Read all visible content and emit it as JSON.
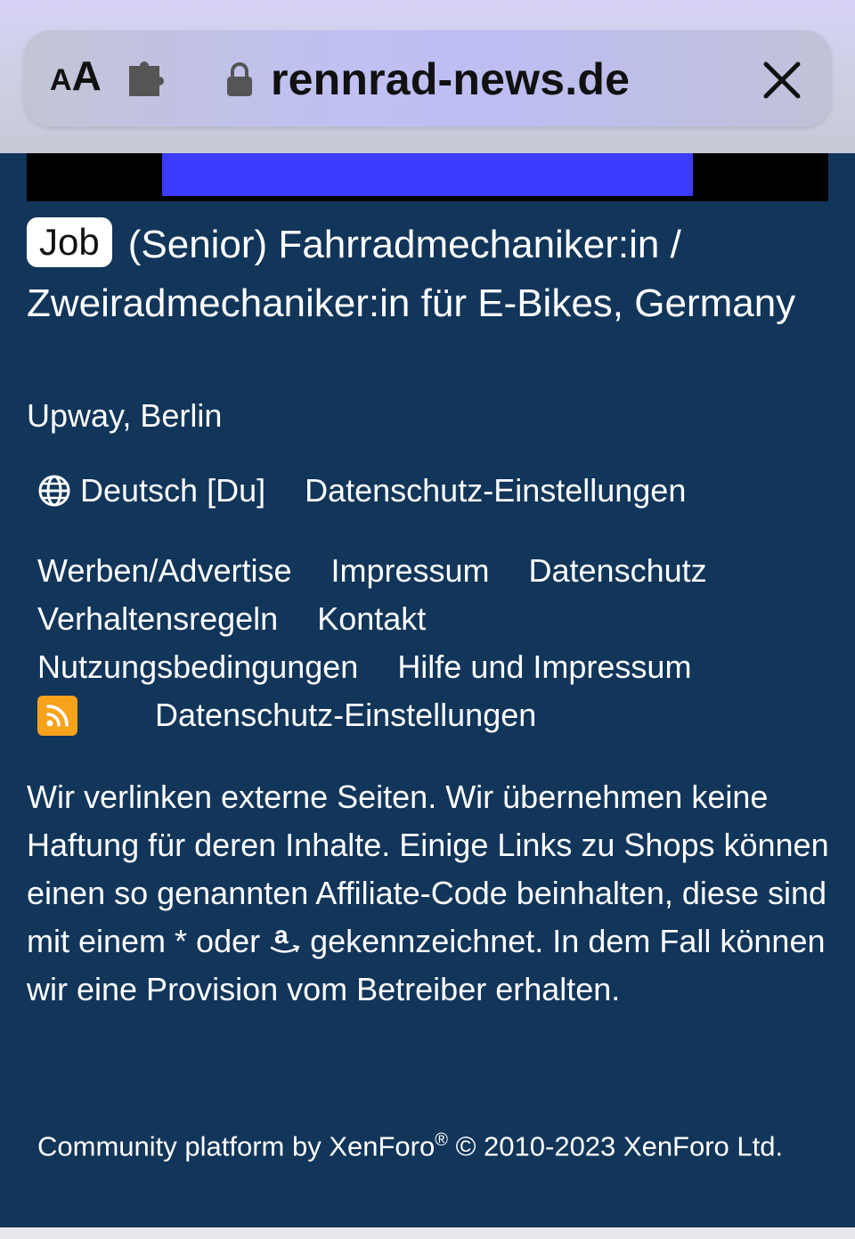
{
  "browser": {
    "text_size_small": "A",
    "text_size_big": "A",
    "url": "rennrad-news.de"
  },
  "job": {
    "badge": "Job",
    "title": "(Senior) Fahrradmechaniker:in / Zweiradmechaniker:in für E-Bikes, Germany",
    "company": "Upway, Berlin"
  },
  "footer": {
    "language": "Deutsch [Du]",
    "privacy_settings_top": "Datenschutz-Einstellungen",
    "links": [
      [
        "Werben/Advertise",
        "Impressum",
        "Datenschutz"
      ],
      [
        "Verhaltensregeln",
        "Kontakt"
      ],
      [
        "Nutzungsbedingungen",
        "Hilfe und Impressum"
      ]
    ],
    "privacy_settings_bottom": "Datenschutz-Einstellungen",
    "disclaimer_part1": "Wir verlinken externe Seiten. Wir übernehmen keine Haftung für deren Inhalte. Einige Links zu Shops können einen so genannten Affiliate-Code beinhalten, diese sind mit einem * oder ",
    "disclaimer_part2": " gekennzeichnet. In dem Fall können wir eine Provision vom Betreiber erhalten.",
    "copyright_part1": "Community platform by XenForo",
    "copyright_reg": "®",
    "copyright_part2": " © 2010-2023 XenForo Ltd."
  },
  "colors": {
    "page_bg": "#12355a",
    "ad_accent": "#3b3bff",
    "rss": "#f7a21b"
  },
  "icons": [
    "text-size-icon",
    "extension-icon",
    "lock-icon",
    "close-icon",
    "globe-icon",
    "rss-icon",
    "amazon-icon"
  ]
}
